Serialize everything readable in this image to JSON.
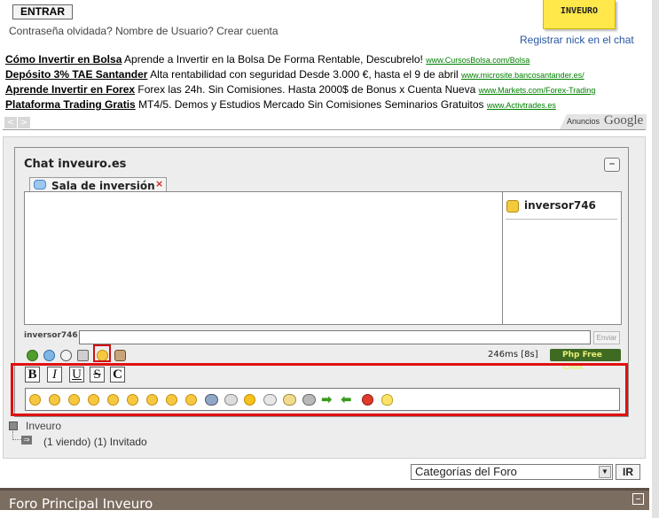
{
  "login": {
    "entrar_label": "ENTRAR",
    "forgot_text": "Contraseña olvidada? Nombre de Usuario? Crear cuenta"
  },
  "logo": {
    "text": "INVEURO"
  },
  "register_link": "Registrar nick en el chat",
  "ads": [
    {
      "title": "Cómo Invertir en Bolsa",
      "desc": "Aprende a Invertir en la Bolsa De Forma Rentable, Descubrelo!",
      "url": "www.CursosBolsa.com/Bolsa"
    },
    {
      "title": "Depósito 3% TAE Santander",
      "desc": "Alta rentabilidad con seguridad Desde 3.000 €, hasta el 9 de abril",
      "url": "www.microsite.bancosantander.es/"
    },
    {
      "title": "Aprende Invertir en Forex",
      "desc": "Forex las 24h. Sin Comisiones. Hasta 2000$ de Bonus x Cuenta Nueva",
      "url": "www.Markets.com/Forex-Trading"
    },
    {
      "title": "Plataforma Trading Gratis",
      "desc": "MT4/5. Demos y Estudios Mercado Sin Comisiones Seminarios Gratuitos",
      "url": "www.Activtrades.es"
    }
  ],
  "ads_brand": {
    "anuncios": "Anuncios",
    "google": "Google"
  },
  "chat": {
    "title": "Chat inveuro.es",
    "collapse_label": "–",
    "tab_label": "Sala de inversión",
    "tab_close": "×",
    "users": [
      "inversor746"
    ],
    "nick": "inversor746",
    "input_value": "",
    "send_label": "Enviar",
    "ping": "246ms [8s]",
    "powered": "Php Free Chat",
    "format_buttons": [
      "B",
      "I",
      "U",
      "S",
      "C"
    ]
  },
  "tree": {
    "label": "Inveuro",
    "viewing": "(1 viendo) (1) Invitado"
  },
  "footer": {
    "category_select": "Categorías del Foro",
    "ir_label": "IR",
    "forum_title": "Foro Principal Inveuro",
    "forum_collapse": "–"
  }
}
